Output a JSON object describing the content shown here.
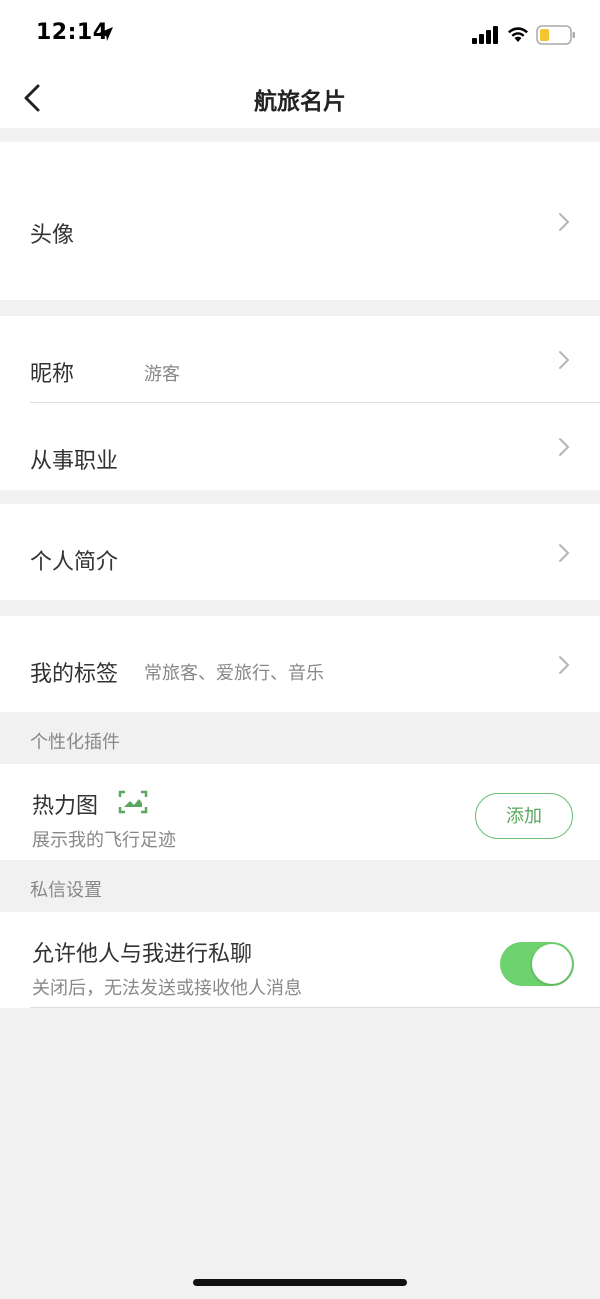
{
  "status_bar": {
    "time": "12:14"
  },
  "nav": {
    "title": "航旅名片"
  },
  "profile": {
    "avatar_label": "头像",
    "nickname_label": "昵称",
    "nickname_value": "游客",
    "occupation_label": "从事职业",
    "bio_label": "个人简介",
    "tags_label": "我的标签",
    "tags_value": "常旅客、爱旅行、音乐"
  },
  "plugins": {
    "header": "个性化插件",
    "heatmap_title": "热力图",
    "heatmap_subtitle": "展示我的飞行足迹",
    "add_label": "添加"
  },
  "privacy": {
    "header": "私信设置",
    "allow_chat_title": "允许他人与我进行私聊",
    "allow_chat_subtitle": "关闭后，无法发送或接收他人消息",
    "allow_chat_enabled": true
  },
  "colors": {
    "accent_green": "#6ed36f",
    "button_green": "#5aa75f",
    "background": "#f1f1f1"
  }
}
